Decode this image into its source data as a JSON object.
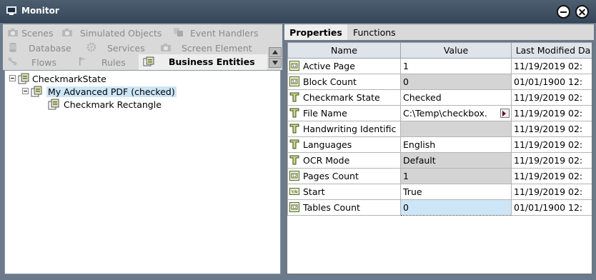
{
  "window": {
    "title": "Monitor"
  },
  "left_tabs": [
    {
      "label": "Scenes",
      "icon": "camera-icon"
    },
    {
      "label": "Simulated Objects",
      "icon": "camera-icon"
    },
    {
      "label": "Event Handlers",
      "icon": "event-icon"
    },
    {
      "label": "Database",
      "icon": "database-icon"
    },
    {
      "label": "Services",
      "icon": "gear-icon"
    },
    {
      "label": "Screen Element",
      "icon": "camera-icon"
    },
    {
      "label": "Flows",
      "icon": "flow-icon"
    },
    {
      "label": "Rules",
      "icon": "flag-icon"
    },
    {
      "label": "Business Entities",
      "icon": "entity-icon"
    }
  ],
  "tree": {
    "root": "CheckmarkState",
    "child": "My Advanced PDF (checked)",
    "grandchild": "Checkmark Rectangle"
  },
  "right_tabs": {
    "properties": "Properties",
    "functions": "Functions"
  },
  "grid": {
    "headers": {
      "name": "Name",
      "value": "Value",
      "modified": "Last Modified Da"
    },
    "rows": [
      {
        "type": "numeric",
        "name": "Active Page",
        "value": "1",
        "modified": "11/19/2019 02:"
      },
      {
        "type": "numeric",
        "name": "Block Count",
        "value": "0",
        "modified": "01/01/1900 12:"
      },
      {
        "type": "text",
        "name": "Checkmark State",
        "value": "Checked",
        "modified": "11/19/2019 02:"
      },
      {
        "type": "text",
        "name": "File Name",
        "value": "C:\\Temp\\checkbox.",
        "modified": "11/19/2019 02:"
      },
      {
        "type": "text",
        "name": "Handwriting Identific",
        "value": "",
        "modified": "11/19/2019 02:"
      },
      {
        "type": "text",
        "name": "Languages",
        "value": "English",
        "modified": "11/19/2019 02:"
      },
      {
        "type": "text",
        "name": "OCR Mode",
        "value": "Default",
        "modified": "11/19/2019 02:"
      },
      {
        "type": "numeric",
        "name": "Pages Count",
        "value": "1",
        "modified": "11/19/2019 02:"
      },
      {
        "type": "boolean",
        "name": "Start",
        "value": "True",
        "modified": "11/19/2019 02:"
      },
      {
        "type": "numeric",
        "name": "Tables Count",
        "value": "0",
        "modified": "01/01/1900 12:"
      }
    ]
  },
  "colors": {
    "titlebar": "#3f5064",
    "selection": "#cde6f7",
    "readonly_cell": "#d4d4d4"
  }
}
